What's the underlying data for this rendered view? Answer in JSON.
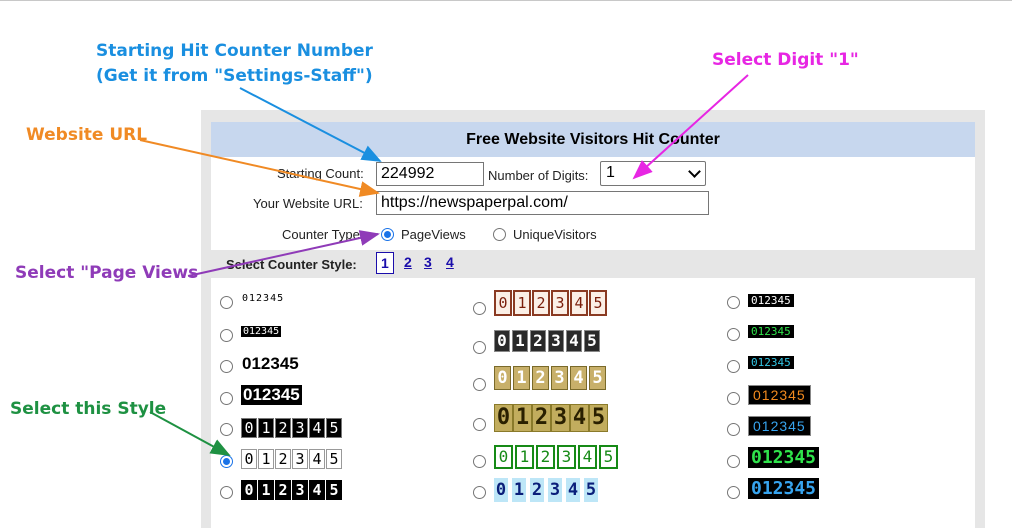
{
  "form": {
    "title": "Free Website Visitors Hit Counter",
    "starting_count_label": "Starting Count:",
    "starting_count_value": "224992",
    "num_digits_label": "Number of Digits:",
    "num_digits_value": "1",
    "url_label": "Your Website URL:",
    "url_value": "https://newspaperpal.com/",
    "counter_type_label": "Counter Type:",
    "counter_types": [
      "PageViews",
      "UniqueVisitors"
    ],
    "selected_counter_type": "PageViews",
    "style_label": "Select Counter Style:",
    "style_pages": [
      "1",
      "2",
      "3",
      "4"
    ],
    "current_page": "1"
  },
  "styles": {
    "sample_digits": "012345",
    "selected_style": "col1-row6"
  },
  "annotations": {
    "starting_line1": "Starting Hit Counter Number",
    "starting_line2": "(Get it from \"Settings-Staff\")",
    "website_url": "Website URL",
    "select_digit": "Select Digit \"1\"",
    "select_page_views": "Select \"Page Views",
    "select_style": "Select this Style"
  },
  "colors": {
    "blue_annotation": "#1a8fe0",
    "orange_annotation": "#f08a24",
    "magenta_annotation": "#e726e3",
    "purple_annotation": "#8f3bb8",
    "green_annotation": "#1e9142",
    "header_bg": "#c7d7ee",
    "link": "#1a0dab"
  }
}
